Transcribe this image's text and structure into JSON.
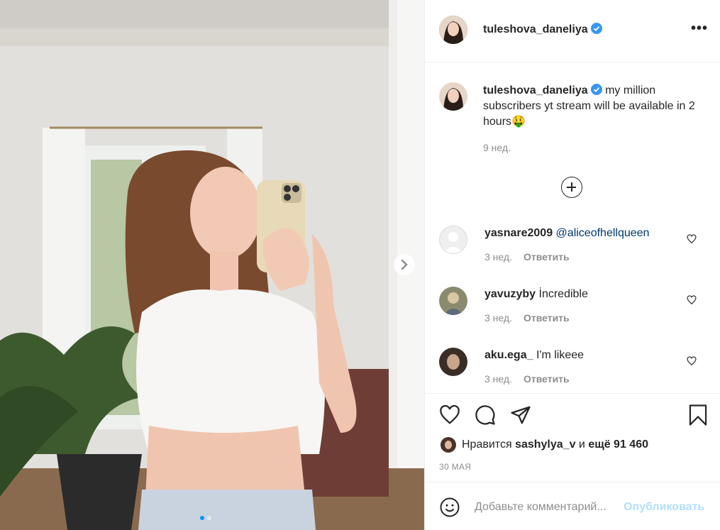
{
  "post": {
    "author": "tuleshova_daneliya",
    "caption": "my million subscribers yt stream will be available in 2 hours🤑",
    "caption_time": "9 нед.",
    "more_label": "•••",
    "likes_prefix": "Нравится",
    "likes_user": "sashylya_v",
    "likes_mid": "и",
    "likes_count": "ещё 91 460",
    "date": "30 МАЯ",
    "slide_count": 2,
    "active_slide": 1
  },
  "comments": [
    {
      "user": "yasnare2009",
      "text": "@aliceofhellqueen",
      "time": "3 нед.",
      "reply": "Ответить"
    },
    {
      "user": "yavuzyby",
      "text": "İncredible",
      "time": "3 нед.",
      "reply": "Ответить"
    },
    {
      "user": "aku.ega_",
      "text": "I'm likeee",
      "time": "3 нед.",
      "reply": "Ответить"
    }
  ],
  "add_comment": {
    "placeholder": "Добавьте комментарий...",
    "publish": "Опубликовать"
  },
  "icons": {
    "verified": "verified-badge-icon",
    "like": "heart-icon",
    "comment": "comment-icon",
    "share": "paper-plane-icon",
    "save": "bookmark-icon",
    "emoji": "emoji-icon",
    "load_more": "plus-circle-icon",
    "next": "chevron-right-icon"
  },
  "colors": {
    "verified": "#3897f0",
    "link": "#00376b",
    "publish_disabled": "#b2dffc",
    "muted": "#8e8e8e"
  }
}
